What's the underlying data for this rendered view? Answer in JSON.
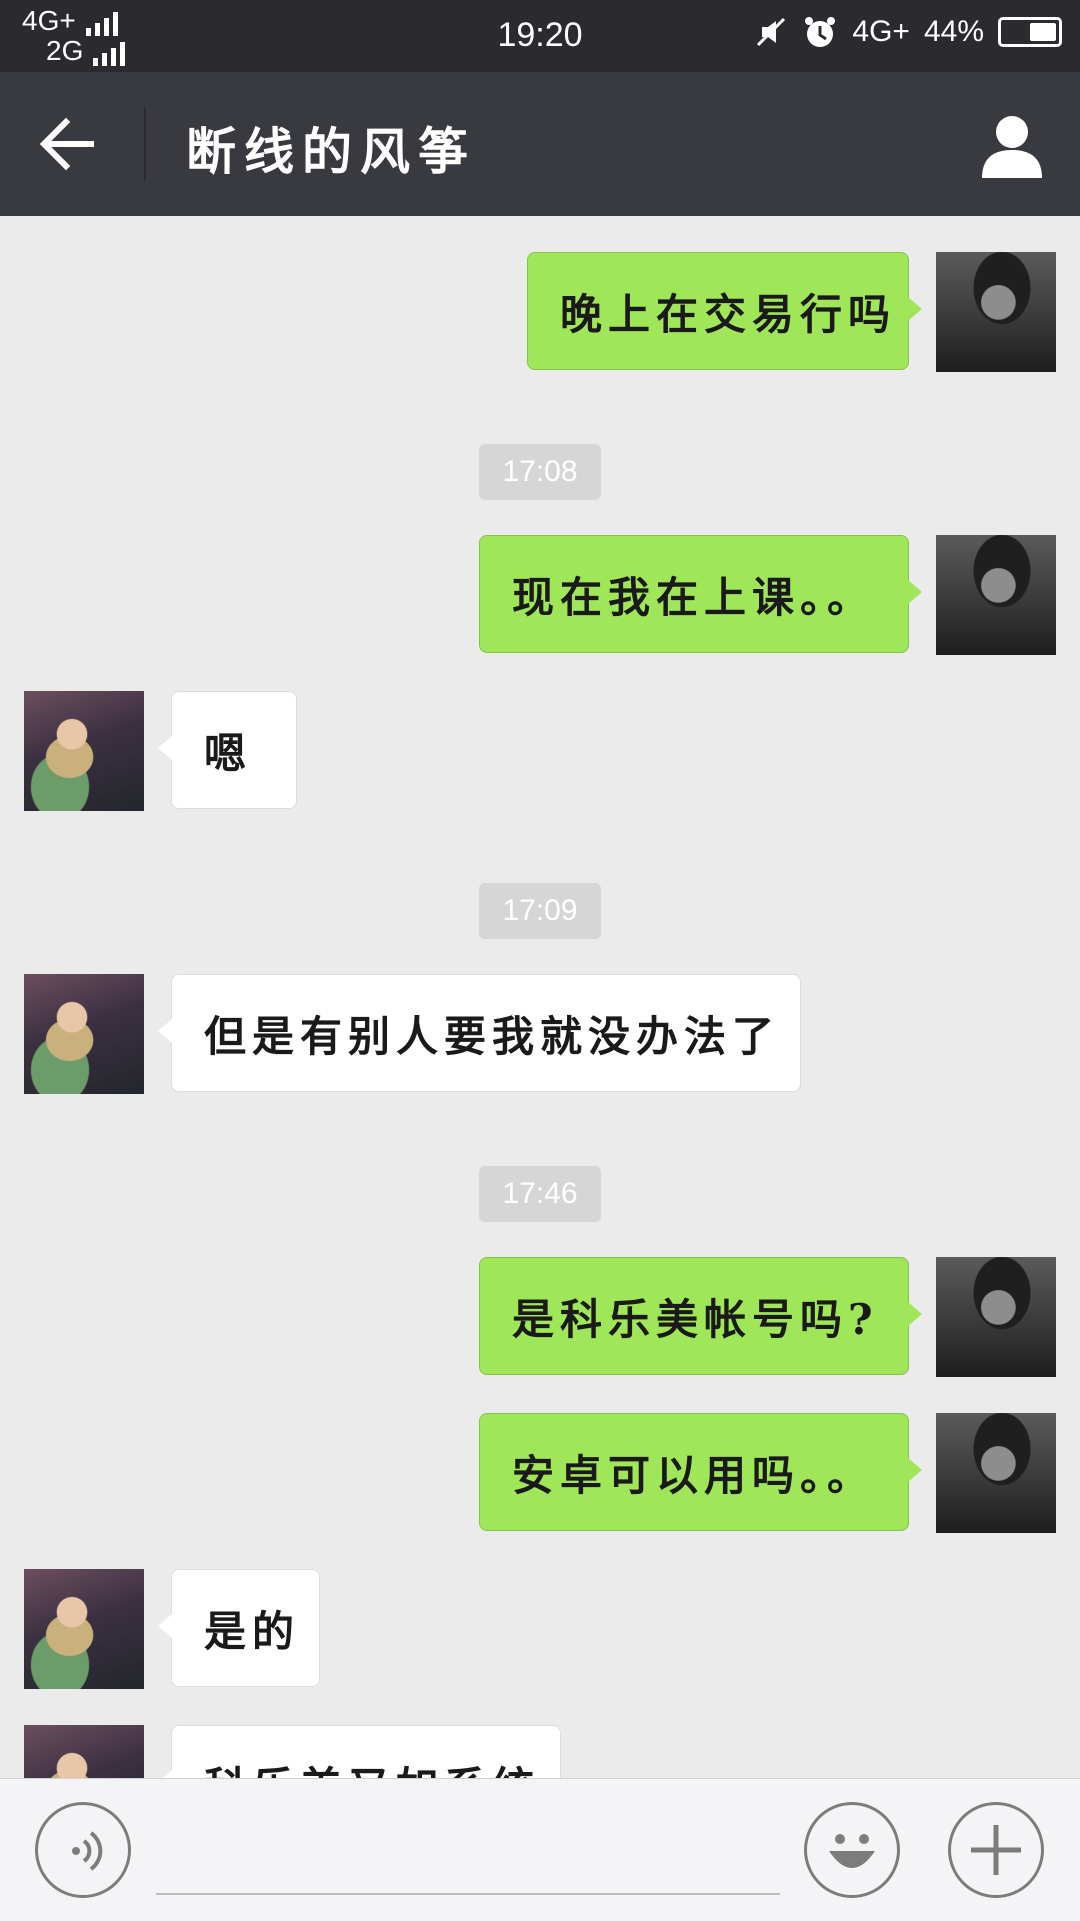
{
  "status_bar": {
    "network_primary": "4G+",
    "network_secondary": "2G",
    "time": "19:20",
    "network_right": "4G+",
    "battery": "44%",
    "icons": [
      "signal-bars-icon",
      "mute-icon",
      "alarm-icon",
      "battery-icon"
    ]
  },
  "header": {
    "title": "断线的风筝",
    "back_icon": "arrow-left-icon",
    "profile_icon": "person-icon"
  },
  "messages": [
    {
      "type": "out",
      "text": "晚上在交易行吗"
    },
    {
      "type": "time",
      "text": "17:08"
    },
    {
      "type": "out",
      "text": "现在我在上课。。"
    },
    {
      "type": "in",
      "text": "嗯"
    },
    {
      "type": "time",
      "text": "17:09"
    },
    {
      "type": "in",
      "text": "但是有别人要我就没办法了"
    },
    {
      "type": "time",
      "text": "17:46"
    },
    {
      "type": "out",
      "text": "是科乐美帐号吗?"
    },
    {
      "type": "out",
      "text": "安卓可以用吗。。"
    },
    {
      "type": "in",
      "text": "是的"
    },
    {
      "type": "in",
      "text": "科乐美又如系统"
    }
  ],
  "input_bar": {
    "voice_icon": "voice-icon",
    "emoji_icon": "emoji-icon",
    "plus_icon": "plus-icon"
  },
  "colors": {
    "outgoing_bubble": "#9fe658",
    "incoming_bubble": "#ffffff",
    "header_bg": "#393a3f",
    "chat_bg": "#ebebeb"
  }
}
